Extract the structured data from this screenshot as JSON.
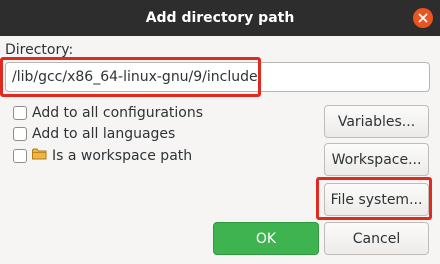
{
  "dialog": {
    "title": "Add directory path",
    "close_icon": "close-icon"
  },
  "directory": {
    "label": "Directory:",
    "value": "/lib/gcc/x86_64-linux-gnu/9/include"
  },
  "options": [
    {
      "label": "Add to all configurations",
      "checked": false
    },
    {
      "label": "Add to all languages",
      "checked": false
    },
    {
      "label": "Is a workspace path",
      "checked": false,
      "icon": "folder-icon"
    }
  ],
  "buttons": {
    "variables": "Variables...",
    "workspace": "Workspace...",
    "file_system": "File system...",
    "ok": "OK",
    "cancel": "Cancel"
  },
  "colors": {
    "titlebar": "#2d2d2d",
    "close_button": "#e95420",
    "ok_button": "#3eb34f",
    "highlight": "#e02a20"
  }
}
